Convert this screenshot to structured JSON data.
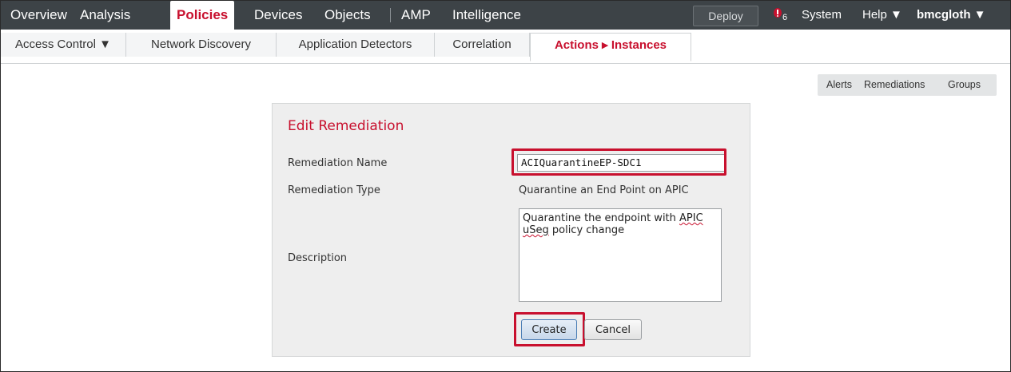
{
  "top_nav": {
    "items": [
      "Overview",
      "Analysis",
      "Policies",
      "Devices",
      "Objects",
      "AMP",
      "Intelligence"
    ],
    "active": "Policies",
    "deploy_label": "Deploy",
    "alert_count": "6",
    "system_label": "System",
    "help_label": "Help ▼",
    "user_label": "bmcgloth ▼"
  },
  "sub_nav": {
    "tabs": [
      "Access Control ▼",
      "Network Discovery",
      "Application Detectors",
      "Correlation",
      "Actions ▸ Instances"
    ],
    "active": "Actions ▸ Instances"
  },
  "side_tabs": [
    "Alerts",
    "Remediations",
    "Groups"
  ],
  "form": {
    "title": "Edit Remediation",
    "name_label": "Remediation Name",
    "name_value": "ACIQuarantineEP-SDC1",
    "type_label": "Remediation Type",
    "type_value": "Quarantine an End Point on APIC",
    "description_label": "Description",
    "description_line1_before": "Quarantine the endpoint with ",
    "description_line1_word": "APIC",
    "description_line2_word": "uSeg",
    "description_line2_after": " policy change",
    "create_label": "Create",
    "cancel_label": "Cancel"
  },
  "colors": {
    "accent": "#c8102e",
    "topbar": "#3d4347",
    "panel": "#eeeeee"
  }
}
